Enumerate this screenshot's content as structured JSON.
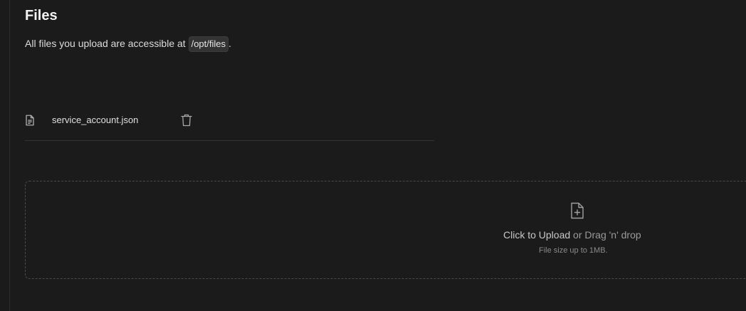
{
  "section": {
    "title": "Files",
    "description_prefix": "All files you upload are accessible at",
    "path": "/opt/files",
    "description_suffix": "."
  },
  "files": [
    {
      "name": "service_account.json",
      "icon": "file-text-icon",
      "action_icon": "trash-icon"
    }
  ],
  "upload": {
    "icon": "file-plus-icon",
    "cta": "Click to Upload",
    "or_text": "or Drag 'n' drop",
    "hint": "File size up to 1MB."
  }
}
